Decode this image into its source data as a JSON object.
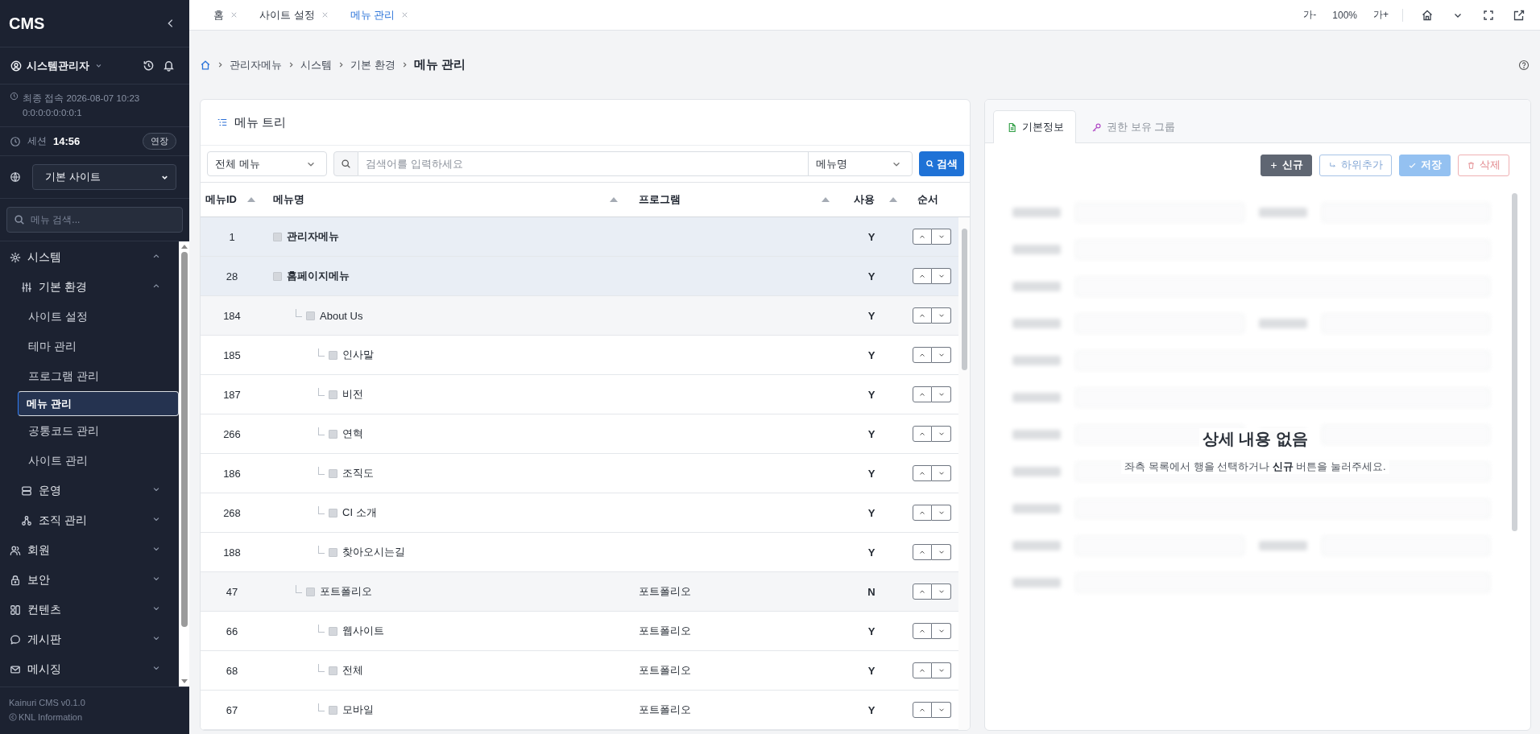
{
  "sidebar": {
    "logo": "CMS",
    "user": "시스템관리자",
    "last_login_label": "최종 접속",
    "last_login_time": "2026-08-07 10:23",
    "last_login_ip": "0:0:0:0:0:0:0:1",
    "session_label": "세션",
    "session_time": "14:56",
    "extend_button": "연장",
    "site_select": "기본 사이트",
    "search_placeholder": "메뉴 검색...",
    "nav": [
      {
        "label": "시스템",
        "expanded": true,
        "selected": false,
        "children": [
          {
            "label": "기본 환경",
            "expanded": true,
            "selected": false,
            "children": [
              {
                "label": "사이트 설정",
                "selected": false
              },
              {
                "label": "테마 관리",
                "selected": false
              },
              {
                "label": "프로그램 관리",
                "selected": false
              },
              {
                "label": "메뉴 관리",
                "selected": true
              },
              {
                "label": "공통코드 관리",
                "selected": false
              },
              {
                "label": "사이트 관리",
                "selected": false
              }
            ]
          },
          {
            "label": "운영",
            "expanded": false,
            "selected": false
          },
          {
            "label": "조직 관리",
            "expanded": false,
            "selected": false
          }
        ]
      },
      {
        "label": "회원",
        "expanded": false,
        "selected": false
      },
      {
        "label": "보안",
        "expanded": false,
        "selected": false
      },
      {
        "label": "컨텐츠",
        "expanded": false,
        "selected": false
      },
      {
        "label": "게시판",
        "expanded": false,
        "selected": false
      },
      {
        "label": "메시징",
        "expanded": false,
        "selected": false
      }
    ],
    "footer": [
      "Kainuri CMS v0.1.0",
      "KNL Information"
    ]
  },
  "tabs": [
    {
      "label": "홈",
      "selected": false
    },
    {
      "label": "사이트 설정",
      "selected": false
    },
    {
      "label": "메뉴 관리",
      "selected": true
    }
  ],
  "toolbar": {
    "font_decrease": "가-",
    "zoom": "100%",
    "font_increase": "가+"
  },
  "breadcrumb": [
    "관리자메뉴",
    "시스템",
    "기본 환경",
    "메뉴 관리"
  ],
  "menu_tree": {
    "title": "메뉴 트리",
    "scope_select": "전체 메뉴",
    "search_placeholder": "검색어를 입력하세요",
    "field_select": "메뉴명",
    "search_button": "검색",
    "columns": [
      "메뉴ID",
      "메뉴명",
      "프로그램",
      "사용",
      "순서"
    ],
    "rows": [
      {
        "id": "1",
        "name": "관리자메뉴",
        "use": "Y"
      },
      {
        "id": "28",
        "name": "홈페이지메뉴",
        "use": "Y",
        "children": [
          {
            "id": "184",
            "name": "About Us",
            "use": "Y",
            "children": [
              {
                "id": "185",
                "name": "인사말",
                "use": "Y"
              },
              {
                "id": "187",
                "name": "비전",
                "use": "Y"
              },
              {
                "id": "266",
                "name": "연혁",
                "use": "Y"
              },
              {
                "id": "186",
                "name": "조직도",
                "use": "Y"
              },
              {
                "id": "268",
                "name": "CI 소개",
                "use": "Y"
              },
              {
                "id": "188",
                "name": "찾아오시는길",
                "use": "Y"
              }
            ]
          },
          {
            "id": "47",
            "name": "포트폴리오",
            "program": "포트폴리오",
            "use": "N",
            "children": [
              {
                "id": "66",
                "name": "웹사이트",
                "program": "포트폴리오",
                "use": "Y"
              },
              {
                "id": "68",
                "name": "전체",
                "program": "포트폴리오",
                "use": "Y"
              },
              {
                "id": "67",
                "name": "모바일",
                "program": "포트폴리오",
                "use": "Y"
              }
            ]
          }
        ]
      }
    ]
  },
  "detail": {
    "tabs": [
      {
        "label": "기본정보",
        "selected": true
      },
      {
        "label": "권한 보유 그룹",
        "selected": false
      }
    ],
    "buttons": [
      {
        "kind": "new",
        "label": "신규",
        "disabled": false
      },
      {
        "kind": "child",
        "label": "하위추가",
        "disabled": false
      },
      {
        "kind": "save",
        "label": "저장",
        "disabled": true
      },
      {
        "kind": "delete",
        "label": "삭제",
        "disabled": false
      }
    ],
    "empty_title": "상세 내용 없음",
    "empty_message": "좌측 목록에서 행을 선택하거나 **신규** 버튼을 눌러주세요."
  }
}
